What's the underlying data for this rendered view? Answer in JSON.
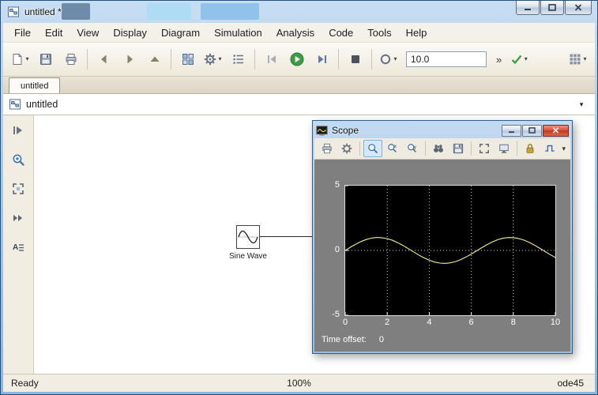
{
  "window": {
    "title": "untitled *"
  },
  "menu": {
    "items": [
      "File",
      "Edit",
      "View",
      "Display",
      "Diagram",
      "Simulation",
      "Analysis",
      "Code",
      "Tools",
      "Help"
    ]
  },
  "toolbar": {
    "stop_time": "10.0"
  },
  "icons": {
    "dropdown": "▾",
    "overflow": "»",
    "chevron_down": "▾"
  },
  "tab": {
    "label": "untitled"
  },
  "breadcrumb": {
    "label": "untitled"
  },
  "palette": {
    "icons": [
      "browser-toggle",
      "zoom-in",
      "fit-view",
      "forward-arrows",
      "annotation"
    ]
  },
  "canvas": {
    "blocks": [
      {
        "label": "Sine Wave"
      }
    ]
  },
  "scope": {
    "title": "Scope",
    "toolbar_icons": [
      "print",
      "settings",
      "zoom",
      "zoom-x",
      "zoom-y",
      "autoscale",
      "save-axes",
      "restore-axes",
      "float-scope",
      "lock-axes",
      "signal-selector"
    ],
    "time_offset_label": "Time offset:",
    "time_offset_value": "0",
    "chart_data": {
      "type": "line",
      "title": "",
      "xlabel": "",
      "ylabel": "",
      "xlim": [
        0,
        10
      ],
      "ylim": [
        -5,
        5
      ],
      "xticks": [
        0,
        2,
        4,
        6,
        8,
        10
      ],
      "yticks": [
        5,
        0,
        -5
      ],
      "grid": "dotted",
      "plot_bg": "#000000",
      "line_color": "#f2ef8f",
      "axis_text_color": "#ffffff",
      "x": [
        0,
        0.25,
        0.5,
        0.75,
        1,
        1.25,
        1.5,
        1.75,
        2,
        2.25,
        2.5,
        2.75,
        3,
        3.25,
        3.5,
        3.75,
        4,
        4.25,
        4.5,
        4.75,
        5,
        5.25,
        5.5,
        5.75,
        6,
        6.25,
        6.5,
        6.75,
        7,
        7.25,
        7.5,
        7.75,
        8,
        8.25,
        8.5,
        8.75,
        9,
        9.25,
        9.5,
        9.75,
        10
      ],
      "series": [
        {
          "name": "Sine Wave",
          "values": [
            0,
            0.247,
            0.479,
            0.682,
            0.841,
            0.949,
            0.997,
            0.984,
            0.909,
            0.778,
            0.599,
            0.382,
            0.141,
            -0.108,
            -0.351,
            -0.572,
            -0.757,
            -0.895,
            -0.978,
            -0.999,
            -0.959,
            -0.859,
            -0.706,
            -0.508,
            -0.279,
            -0.033,
            0.215,
            0.45,
            0.657,
            0.823,
            0.938,
            0.995,
            0.989,
            0.922,
            0.798,
            0.625,
            0.412,
            0.174,
            -0.075,
            -0.32,
            -0.544
          ]
        }
      ]
    }
  },
  "statusbar": {
    "left": "Ready",
    "zoom": "100%",
    "solver": "ode45"
  }
}
